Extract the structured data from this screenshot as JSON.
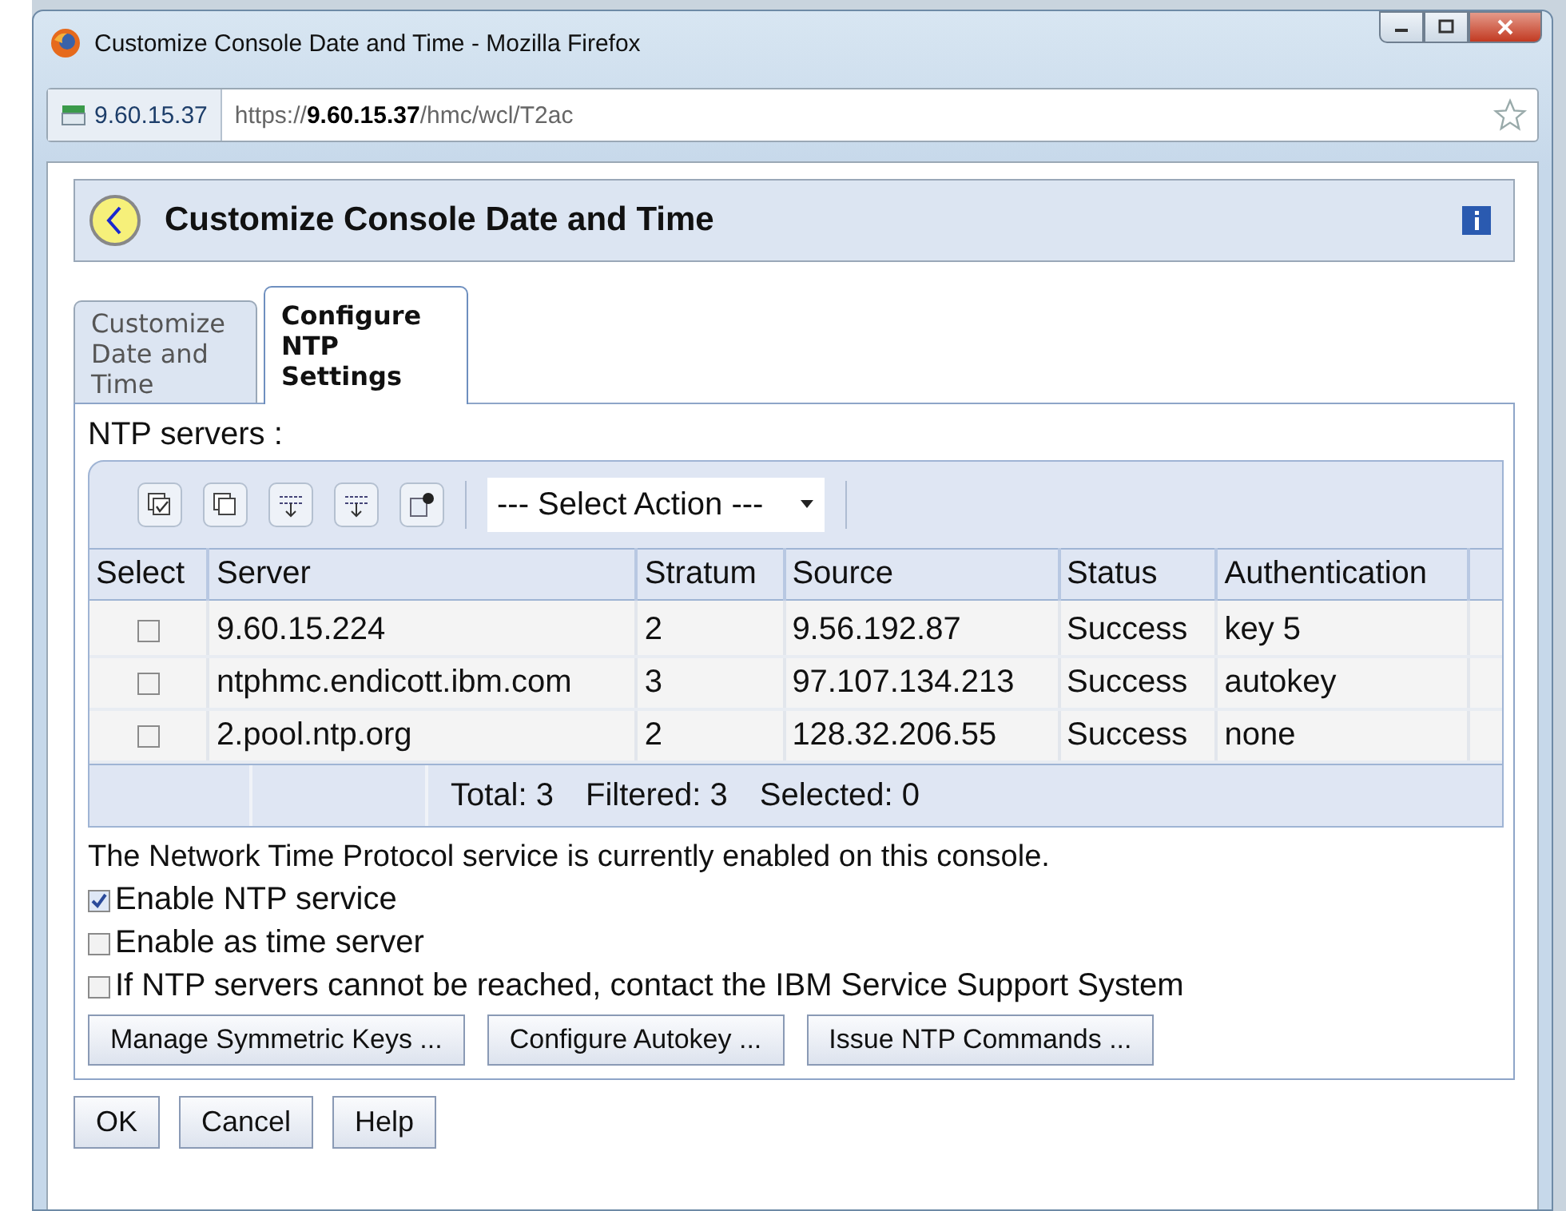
{
  "window": {
    "title": "Customize Console Date and Time - Mozilla Firefox"
  },
  "address_bar": {
    "site": "9.60.15.37",
    "url": "https://**9.60.15.37**/hmc/wcl/T2ac"
  },
  "page": {
    "title": "Customize Console Date and Time"
  },
  "tabs": [
    {
      "label": "Customize Date and Time",
      "selected": false
    },
    {
      "label": "Configure NTP Settings",
      "selected": true
    }
  ],
  "servers_label": "NTP servers :",
  "toolbar": {
    "action_select": "--- Select Action ---"
  },
  "table": {
    "columns": [
      "Select",
      "Server",
      "Stratum",
      "Source",
      "Status",
      "Authentication"
    ],
    "rows": [
      {
        "checked": false,
        "cells": [
          "",
          "9.60.15.224",
          "2",
          "9.56.192.87",
          "Success",
          "key 5"
        ]
      },
      {
        "checked": false,
        "cells": [
          "",
          "ntphmc.endicott.ibm.com",
          "3",
          "97.107.134.213",
          "Success",
          "autokey"
        ]
      },
      {
        "checked": false,
        "cells": [
          "",
          "2.pool.ntp.org",
          "2",
          "128.32.206.55",
          "Success",
          "none"
        ]
      }
    ],
    "footer": {
      "total": "Total: 3",
      "filtered": "Filtered: 3",
      "selected": "Selected: 0"
    }
  },
  "status_text": "The Network Time Protocol service is currently enabled on this console.",
  "options": [
    {
      "label": "Enable NTP service",
      "checked": true
    },
    {
      "label": "Enable as time server",
      "checked": false
    },
    {
      "label": "If NTP servers cannot be reached, contact the IBM Service Support System",
      "checked": false
    }
  ],
  "panel_buttons": [
    "Manage Symmetric Keys ...",
    "Configure Autokey ...",
    "Issue NTP Commands ..."
  ],
  "dialog_buttons": [
    "OK",
    "Cancel",
    "Help"
  ]
}
